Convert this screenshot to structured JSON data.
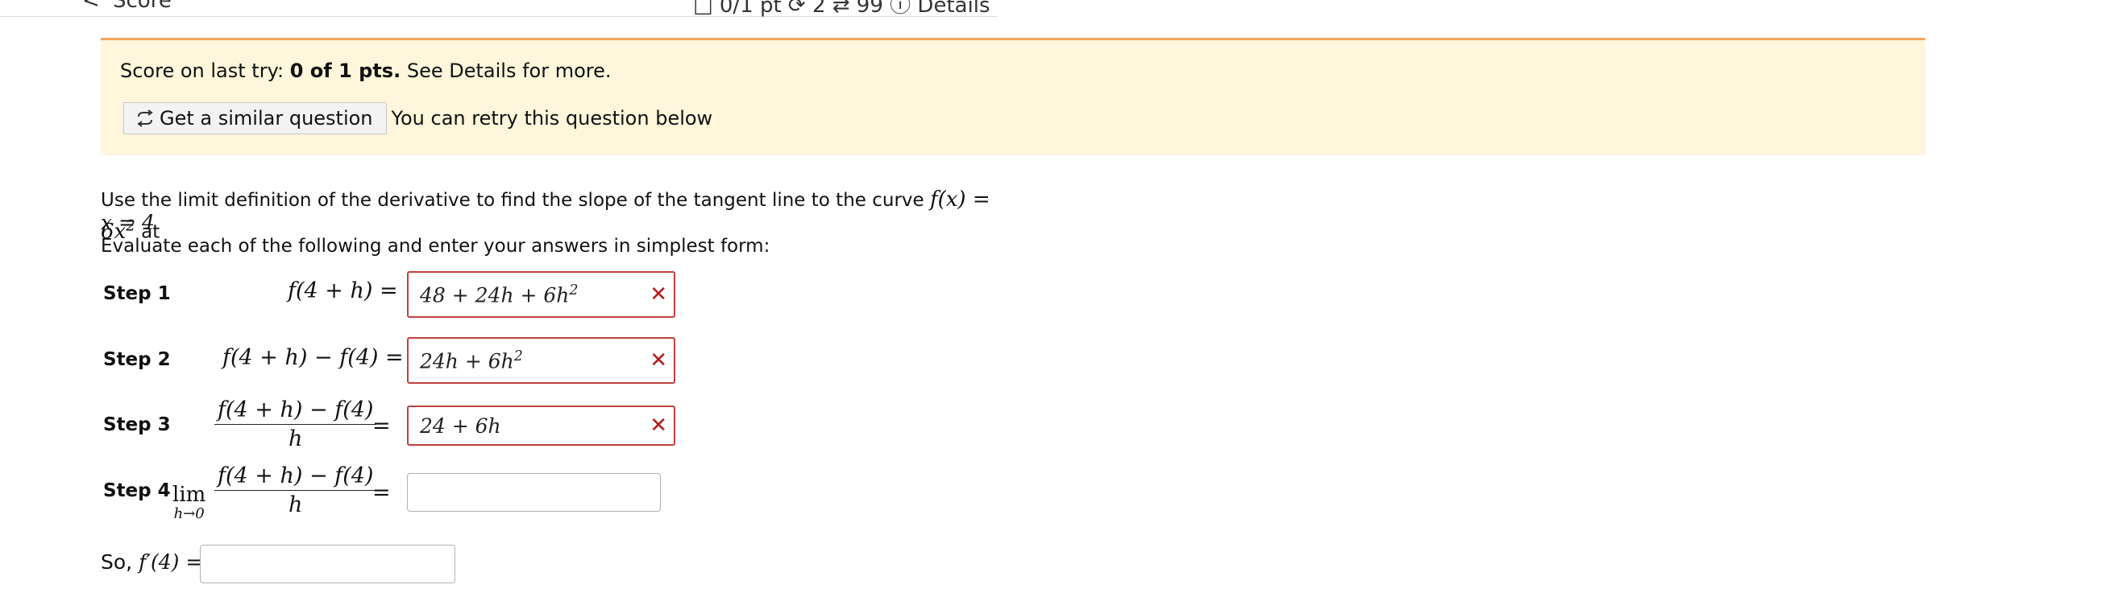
{
  "topbar": {
    "left_fragment_1": "<",
    "left_fragment_2": "Score",
    "right_fragment": "□ 0/1 pt ⟳ 2 ⇄ 99 ⓘ Details"
  },
  "banner": {
    "score_prefix": "Score on last try:",
    "score_value": "0 of 1 pts.",
    "score_suffix": "See Details for more.",
    "similar_button": "Get a similar question",
    "retry_text": "You can retry this question below"
  },
  "question": {
    "intro": "Use the limit definition of the derivative to find the slope of the tangent line to the curve",
    "fx": "f(x) = 6x",
    "fx_exp": "2",
    "at": "at",
    "point": "x = 4",
    "instruction": "Evaluate each of the following and enter your answers in simplest form:"
  },
  "steps": [
    {
      "label": "Step 1",
      "lhs": "f(4 + h) =",
      "answer": "48 + 24h + 6h",
      "answer_exp": "2",
      "status": "incorrect"
    },
    {
      "label": "Step 2",
      "lhs": "f(4 + h) − f(4) =",
      "answer": "24h + 6h",
      "answer_exp": "2",
      "status": "incorrect"
    },
    {
      "label": "Step 3",
      "num": "f(4 + h) − f(4)",
      "den": "h",
      "eq": "=",
      "answer": "24 + 6h",
      "status": "incorrect"
    },
    {
      "label": "Step 4",
      "lim": "lim",
      "lim_sub": "h→0",
      "num": "f(4 + h) − f(4)",
      "den": "h",
      "eq": "=",
      "answer": ""
    }
  ],
  "final": {
    "label": "So,",
    "expr": "f′(4) =",
    "answer": ""
  },
  "icons": {
    "retry": "retry-arrows-icon",
    "incorrect": "x-mark-icon"
  },
  "colors": {
    "banner_bg": "#fff6db",
    "banner_border": "#f2a55c",
    "error": "#c24040"
  }
}
